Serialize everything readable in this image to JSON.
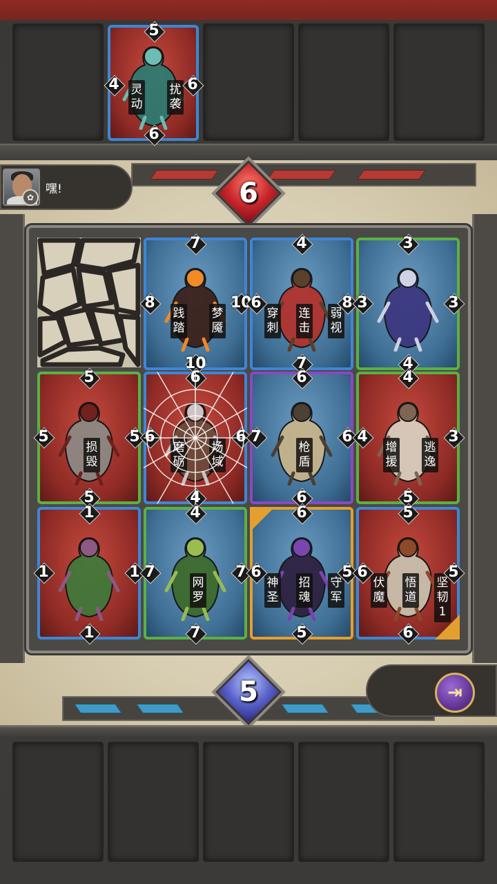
{
  "opponent_hand": {
    "slot_count": 5,
    "cards": [
      {
        "slot": 2,
        "color": "#3e86d6",
        "stats": {
          "top": "5",
          "right": "6",
          "bottom": "6",
          "left": "4"
        },
        "skills": [
          "灵动",
          "扰袭"
        ],
        "art": "siren-icon"
      }
    ]
  },
  "player": {
    "chat": "嘿!",
    "avatar": "player-avatar-icon",
    "badge": "lotus-icon"
  },
  "opponent_counter": {
    "value": "6",
    "color": "#c7262b"
  },
  "player_counter": {
    "value": "5",
    "color": "#5a62c9"
  },
  "board": {
    "rows": [
      [
        {
          "type": "rock"
        },
        {
          "type": "card",
          "border": "blue",
          "bg": "blue",
          "stats": {
            "top": "7",
            "right": "10",
            "bottom": "10",
            "left": "8"
          },
          "skills": [
            "践踏",
            "梦魇"
          ],
          "art": "nightmare-horse-icon"
        },
        {
          "type": "card",
          "border": "blue",
          "bg": "blue",
          "stats": {
            "top": "4",
            "right": "8",
            "bottom": "7",
            "left": "6"
          },
          "skills": [
            "穿刺",
            "连击",
            "弱视"
          ],
          "art": "cyclops-icon"
        },
        {
          "type": "card",
          "border": "green",
          "bg": "blue",
          "stats": {
            "top": "3",
            "right": "3",
            "bottom": "4",
            "left": "3"
          },
          "skills": [],
          "art": "wraith-icon"
        }
      ],
      [
        {
          "type": "card",
          "border": "green",
          "bg": "red",
          "stats": {
            "top": "5",
            "right": "5",
            "bottom": "5",
            "left": "5"
          },
          "skills": [
            "损毁"
          ],
          "art": "skeleton-spearman-icon"
        },
        {
          "type": "card",
          "border": "blue",
          "bg": "red",
          "stats": {
            "top": "6",
            "right": "6",
            "bottom": "4",
            "left": "6"
          },
          "skills": [
            "磨砺",
            "场域"
          ],
          "art": "gladiator-icon",
          "webbed": true
        },
        {
          "type": "card",
          "border": "purple",
          "bg": "blue",
          "stats": {
            "top": "6",
            "right": "6",
            "bottom": "6",
            "left": "7"
          },
          "skills": [
            "枪盾"
          ],
          "art": "chariot-icon"
        },
        {
          "type": "card",
          "border": "green",
          "bg": "red",
          "stats": {
            "top": "4",
            "right": "3",
            "bottom": "5",
            "left": "4"
          },
          "skills": [
            "增援",
            "逃逸"
          ],
          "art": "goat-icon"
        }
      ],
      [
        {
          "type": "card",
          "border": "blue",
          "bg": "red",
          "stats": {
            "top": "1",
            "right": "1",
            "bottom": "1",
            "left": "1"
          },
          "skills": [],
          "art": "fairy-icon"
        },
        {
          "type": "card",
          "border": "green",
          "bg": "blue",
          "stats": {
            "top": "4",
            "right": "7",
            "bottom": "7",
            "left": "7"
          },
          "skills": [
            "网罗"
          ],
          "art": "spider-icon"
        },
        {
          "type": "card",
          "border": "gold",
          "bg": "blue",
          "stats": {
            "top": "6",
            "right": "5",
            "bottom": "5",
            "left": "6"
          },
          "skills": [
            "神圣",
            "招魂",
            "守军"
          ],
          "art": "reaper-icon",
          "corner": "tl"
        },
        {
          "type": "card",
          "border": "blue",
          "bg": "red",
          "stats": {
            "top": "5",
            "right": "5",
            "bottom": "6",
            "left": "6"
          },
          "skills": [
            "伏魔",
            "悟道",
            "坚韧1"
          ],
          "art": "monk-icon",
          "corner": "br"
        }
      ]
    ]
  },
  "exit_button": {
    "icon": "exit-door-icon"
  },
  "player_hand": {
    "slot_count": 5
  }
}
